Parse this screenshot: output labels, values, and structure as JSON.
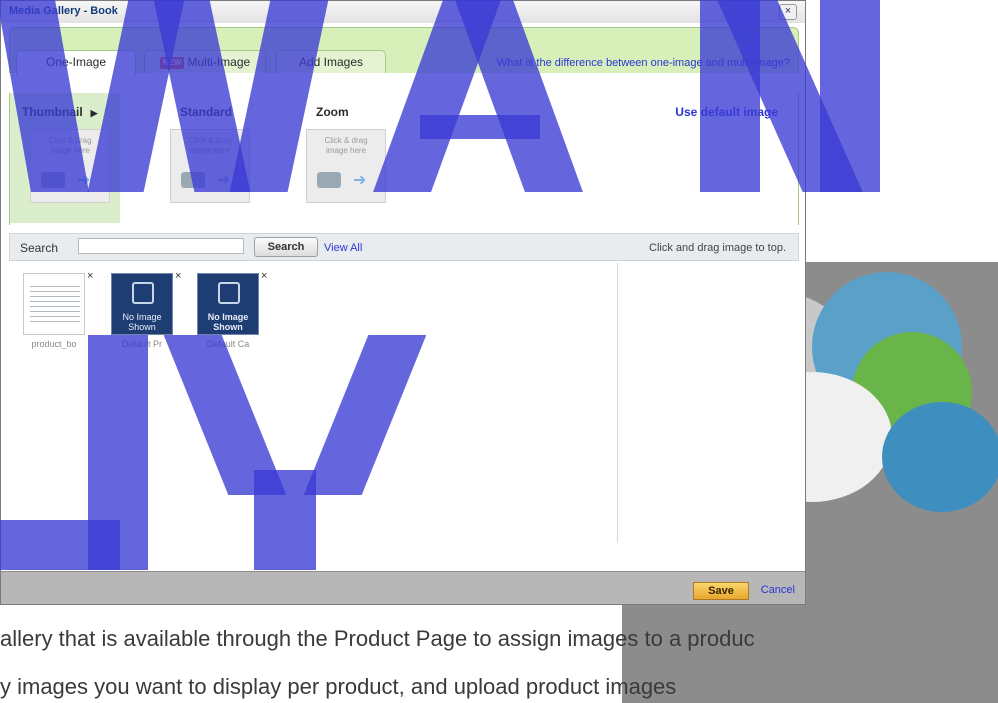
{
  "dialog": {
    "title": "Media Gallery - Book",
    "close_label": "×"
  },
  "tabs": [
    {
      "label": "One-Image",
      "active": true
    },
    {
      "badge": "NEW",
      "label": "Multi-Image",
      "active": false
    },
    {
      "label": "Add Images",
      "active": false
    }
  ],
  "help_link": "What is the difference between one-image and multi-image?",
  "slots": [
    {
      "label": "Thumbnail",
      "arrow": "▶",
      "drop_text": "Click & drag image here",
      "active": true
    },
    {
      "label": "Standard",
      "drop_text": "Click & drag image here",
      "active": false
    },
    {
      "label": "Zoom",
      "drop_text": "Click & drag image here",
      "active": false
    }
  ],
  "use_default": "Use default image",
  "search": {
    "label": "Search",
    "value": "",
    "button": "Search",
    "view_all": "View All",
    "hint": "Click and drag image to top."
  },
  "images": [
    {
      "caption": "product_bo",
      "type": "screenshot",
      "remove": "×"
    },
    {
      "caption": "Default Pr",
      "type": "no-image",
      "overlay": "No Image Shown",
      "remove": "×"
    },
    {
      "caption": "Default Ca",
      "type": "no-image",
      "overlay": "No Image Shown",
      "remove": "×"
    }
  ],
  "footer": {
    "save": "Save",
    "cancel": "Cancel"
  },
  "page_text": {
    "line1": "allery that is available through the Product Page to assign images to a produc",
    "line2": "y images you want to display per product, and upload product images"
  },
  "colors": {
    "watermark": "#3a3bd3",
    "tab_bar": "#d7efb8",
    "link": "#2a35d8",
    "save_button": "#f0b84a",
    "no_image_tile": "#1d3d73"
  }
}
